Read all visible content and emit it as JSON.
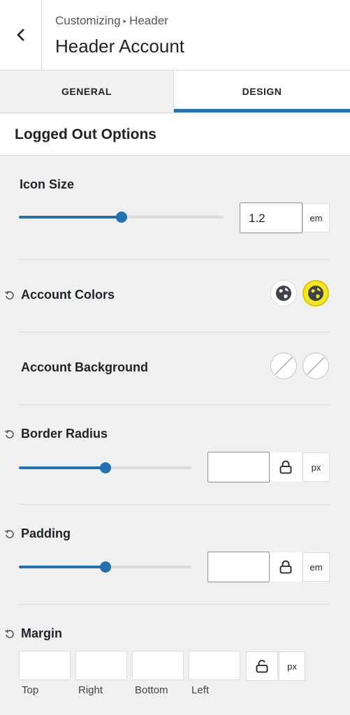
{
  "header": {
    "breadcrumb_parent": "Customizing",
    "breadcrumb_child": "Header",
    "title": "Header Account"
  },
  "tabs": [
    {
      "label": "GENERAL",
      "active": false
    },
    {
      "label": "DESIGN",
      "active": true
    }
  ],
  "section": {
    "title": "Logged Out Options"
  },
  "icon_size": {
    "label": "Icon Size",
    "value": "1.2",
    "unit": "em",
    "slider_fraction": 0.5
  },
  "account_colors": {
    "label": "Account Colors",
    "swatch_normal": "#ffffff",
    "swatch_hover": "#f5e71b"
  },
  "account_background": {
    "label": "Account Background"
  },
  "border_radius": {
    "label": "Border Radius",
    "value": "",
    "unit": "px",
    "slider_fraction": 0.5
  },
  "padding": {
    "label": "Padding",
    "value": "",
    "unit": "em",
    "slider_fraction": 0.5
  },
  "margin": {
    "label": "Margin",
    "unit": "px",
    "fields": [
      {
        "label": "Top",
        "value": ""
      },
      {
        "label": "Right",
        "value": ""
      },
      {
        "label": "Bottom",
        "value": ""
      },
      {
        "label": "Left",
        "value": ""
      }
    ]
  },
  "colors": {
    "accent": "#2271b1",
    "highlight": "#f5e71b"
  }
}
